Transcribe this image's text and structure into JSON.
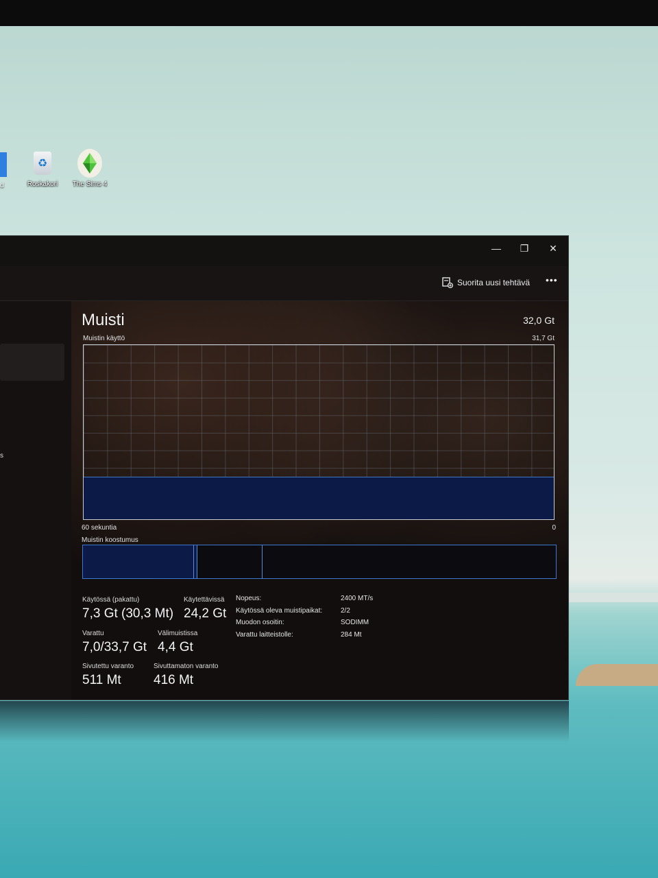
{
  "desktop": {
    "partial_icon_label": "d",
    "icons": [
      {
        "label": "Roskakori"
      },
      {
        "label": "The Sims 4"
      }
    ]
  },
  "window": {
    "controls": {
      "minimize": "—",
      "maximize": "❐",
      "close": "✕"
    },
    "toolbar": {
      "run_task": "Suorita uusi tehtävä",
      "more": "•••"
    },
    "sidebar": {
      "fragment": "s"
    },
    "memory": {
      "title": "Muisti",
      "total": "32,0 Gt",
      "graph_label": "Muistin käyttö",
      "graph_max": "31,7 Gt",
      "x_start": "60 sekuntia",
      "x_end": "0",
      "composition_label": "Muistin koostumus",
      "usage_fraction": 0.24,
      "composition": {
        "in_use_fraction": 0.235,
        "modified_fraction": 0.007,
        "standby_fraction": 0.138
      },
      "stats": {
        "in_use": {
          "label": "Käytössä (pakattu)",
          "value": "7,3 Gt (30,3 Mt)"
        },
        "available": {
          "label": "Käytettävissä",
          "value": "24,2 Gt"
        },
        "committed": {
          "label": "Varattu",
          "value": "7,0/33,7 Gt"
        },
        "cached": {
          "label": "Välimuistissa",
          "value": "4,4 Gt"
        },
        "paged_pool": {
          "label": "Sivutettu varanto",
          "value": "511 Mt"
        },
        "nonpaged_pool": {
          "label": "Sivuttamaton varanto",
          "value": "416 Mt"
        }
      },
      "properties": [
        {
          "label": "Nopeus:",
          "value": "2400 MT/s"
        },
        {
          "label": "Käytössä oleva muistipaikat:",
          "value": "2/2"
        },
        {
          "label": "Muodon osoitin:",
          "value": "SODIMM"
        },
        {
          "label": "Varattu laitteistolle:",
          "value": "284 Mt"
        }
      ]
    }
  }
}
